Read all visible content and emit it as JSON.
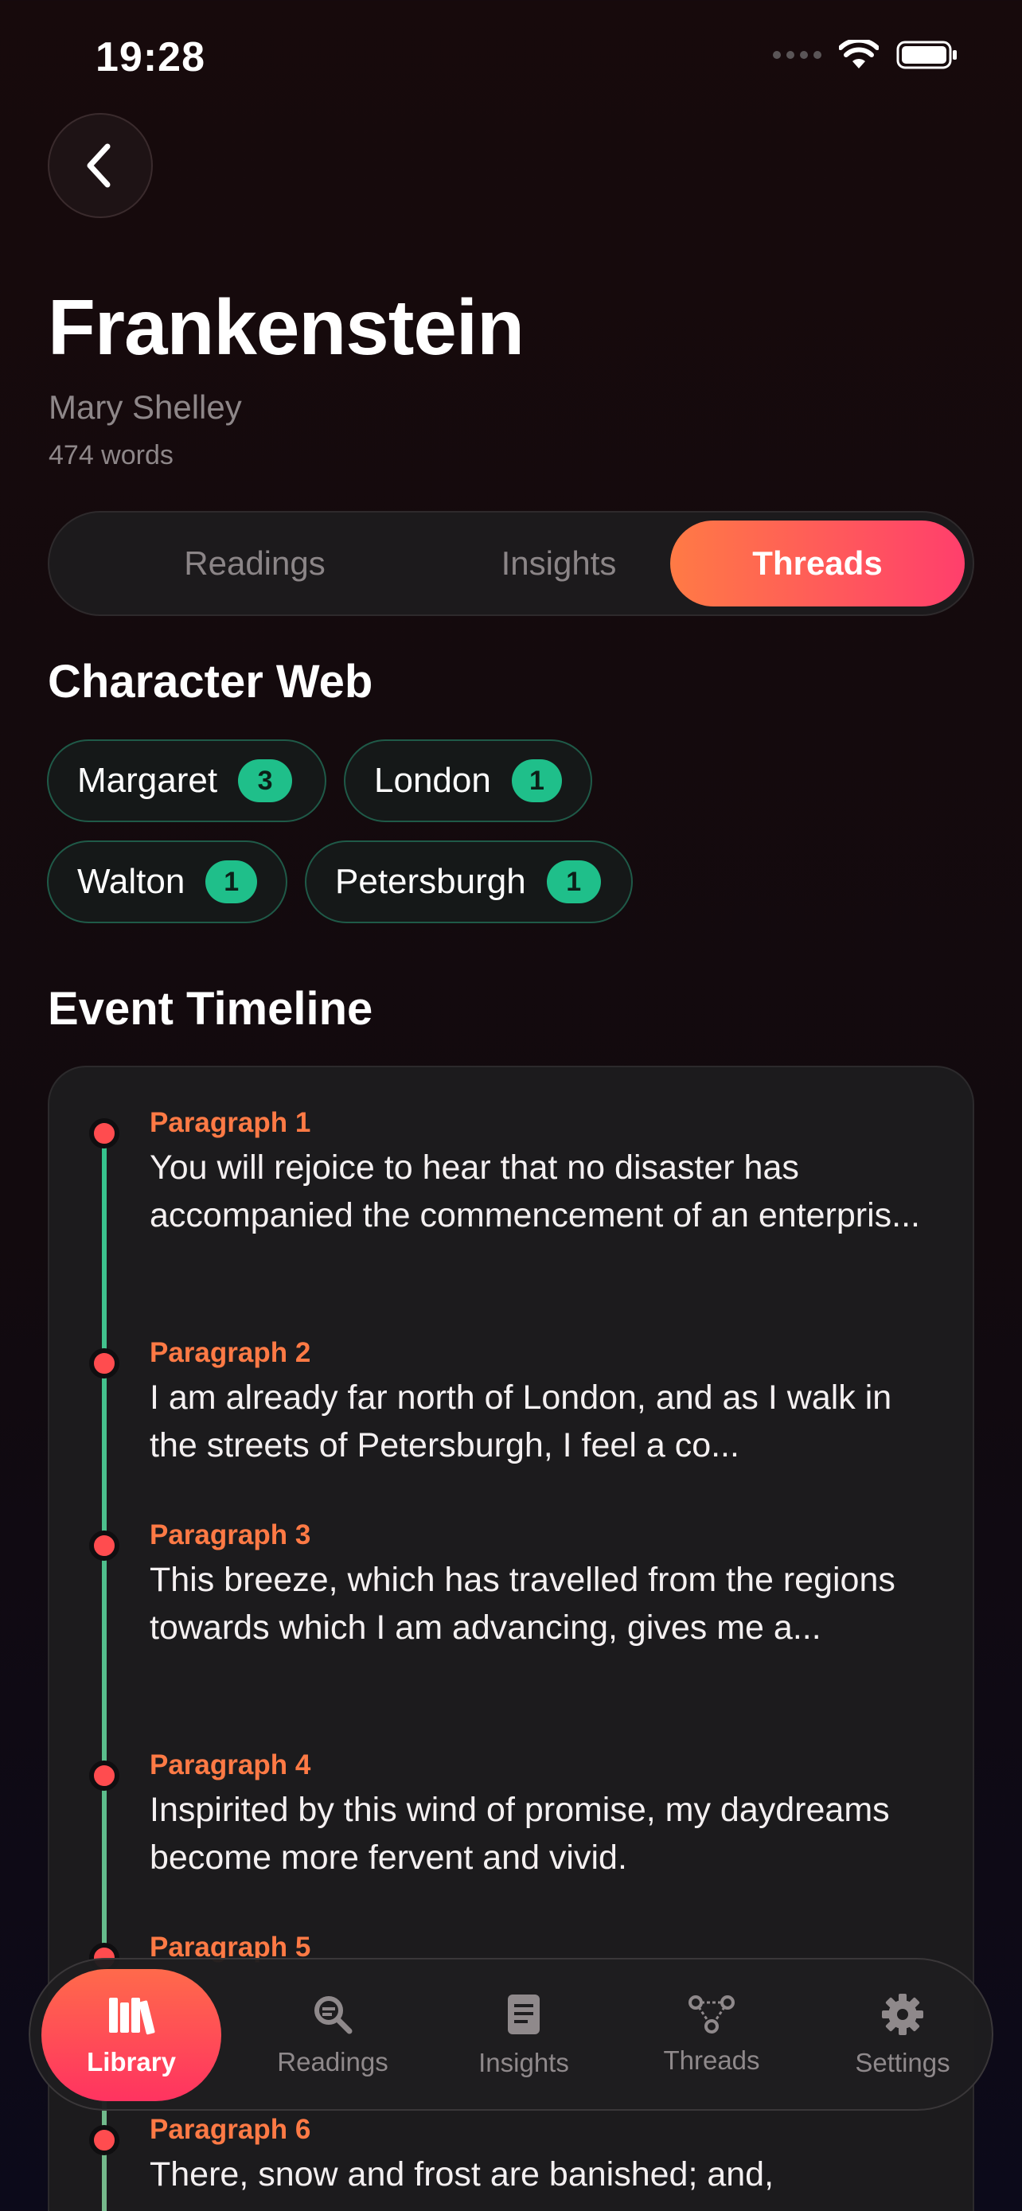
{
  "status": {
    "time": "19:28"
  },
  "book": {
    "title": "Frankenstein",
    "author": "Mary Shelley",
    "words": "474 words"
  },
  "tabs": [
    {
      "label": "Readings",
      "active": false
    },
    {
      "label": "Insights",
      "active": false
    },
    {
      "label": "Threads",
      "active": true
    }
  ],
  "character_web": {
    "title": "Character Web",
    "chips": [
      {
        "name": "Margaret",
        "count": "3"
      },
      {
        "name": "London",
        "count": "1"
      },
      {
        "name": "Walton",
        "count": "1"
      },
      {
        "name": "Petersburgh",
        "count": "1"
      }
    ]
  },
  "timeline": {
    "title": "Event Timeline",
    "events": [
      {
        "label": "Paragraph 1",
        "text": "You will rejoice to hear that no disaster has accompanied the commencement of an enterpris..."
      },
      {
        "label": "Paragraph 2",
        "text": "I am already far north of London, and as I walk in the streets of Petersburgh, I feel a co..."
      },
      {
        "label": "Paragraph 3",
        "text": "This breeze, which has travelled from the regions towards which I am advancing, gives me a..."
      },
      {
        "label": "Paragraph 4",
        "text": "Inspirited by this wind of promise, my daydreams become more fervent and vivid."
      },
      {
        "label": "Paragraph 5",
        "text": ""
      },
      {
        "label": "Paragraph 6",
        "text": "There, snow and frost are banished; and,"
      }
    ]
  },
  "nav": {
    "items": [
      {
        "label": "Library",
        "icon": "library-icon",
        "active": true
      },
      {
        "label": "Readings",
        "icon": "search-doc-icon",
        "active": false
      },
      {
        "label": "Insights",
        "icon": "document-icon",
        "active": false
      },
      {
        "label": "Threads",
        "icon": "graph-icon",
        "active": false
      },
      {
        "label": "Settings",
        "icon": "gear-icon",
        "active": false
      }
    ]
  },
  "colors": {
    "accent_start": "#ff7a45",
    "accent_end": "#ff3f6c",
    "badge": "#1fbf8a",
    "dot": "#ff4c4f"
  }
}
